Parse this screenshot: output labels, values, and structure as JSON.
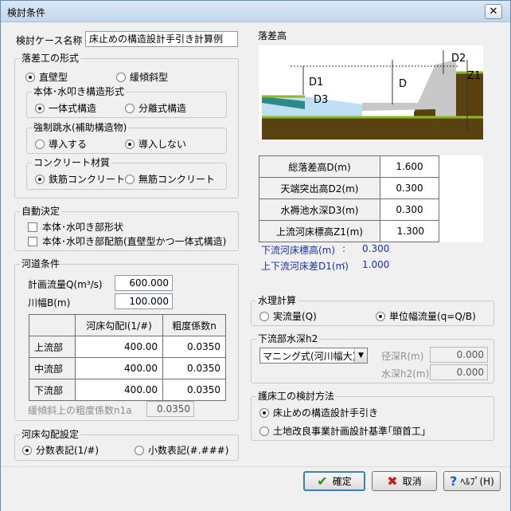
{
  "window": {
    "title": "検討条件",
    "close_glyph": "✕"
  },
  "case": {
    "label": "検討ケース名称",
    "value": "床止めの構造設計手引き計算例"
  },
  "drop_form": {
    "legend": "落差工の形式",
    "options": [
      "直壁型",
      "緩傾斜型"
    ],
    "selected": 0,
    "body": {
      "legend": "本体･水叩き構造形式",
      "options": [
        "一体式構造",
        "分離式構造"
      ],
      "selected": 0
    },
    "jump": {
      "legend": "強制跳水(補助構造物)",
      "options": [
        "導入する",
        "導入しない"
      ],
      "selected": 1
    },
    "concrete": {
      "legend": "コンクリート材質",
      "options": [
        "鉄筋コンクリート",
        "無筋コンクリート"
      ],
      "selected": 0
    }
  },
  "auto": {
    "legend": "自動決定",
    "items": [
      "本体･水叩き部形状",
      "本体･水叩き部配筋(直壁型かつ一体式構造)"
    ]
  },
  "river": {
    "legend": "河道条件",
    "flow_label": "計画流量Q(m³/s)",
    "flow_value": "600.000",
    "width_label": "川幅B(m)",
    "width_value": "100.000",
    "table": {
      "headers": [
        "",
        "河床勾配I(1/#)",
        "粗度係数n"
      ],
      "rows": [
        [
          "上流部",
          "400.00",
          "0.0350"
        ],
        [
          "中流部",
          "400.00",
          "0.0350"
        ],
        [
          "下流部",
          "400.00",
          "0.0350"
        ]
      ]
    },
    "slope_n_label": "緩傾斜上の粗度係数n1a",
    "slope_n_value": "0.0350"
  },
  "gradient_setting": {
    "legend": "河床勾配設定",
    "options": [
      "分数表記(1/#)",
      "小数表記(#.###)"
    ],
    "selected": 0
  },
  "drop_height": {
    "legend": "落差高",
    "diagram_labels": {
      "d1": "D1",
      "d2": "D2",
      "d3": "D3",
      "d": "D",
      "z1": "Z1"
    },
    "rows": [
      {
        "label": "総落差高D(m)",
        "value": "1.600"
      },
      {
        "label": "天端突出高D2(m)",
        "value": "0.300"
      },
      {
        "label": "水褥池水深D3(m)",
        "value": "0.300"
      },
      {
        "label": "上流河床標高Z1(m)",
        "value": "1.300"
      }
    ],
    "downstream_bed": {
      "label": "下流河床標高(m)",
      "sep": ":",
      "value": "0.300"
    },
    "bed_diff": {
      "label": "上下流河床差D1(m)",
      "sep": ":",
      "value": "1.000"
    }
  },
  "hydraulics": {
    "legend": "水理計算",
    "options": [
      "実流量(Q)",
      "単位幅流量(q=Q/B)"
    ],
    "selected": 1
  },
  "downstream_depth": {
    "legend": "下流部水深h2",
    "method": "マニング式(河川幅大)",
    "radius_label": "径深R(m)",
    "radius_value": "0.000",
    "depth_label": "水深h2(m)",
    "depth_value": "0.000"
  },
  "protection": {
    "legend": "護床工の検討方法",
    "options": [
      "床止めの構造設計手引き",
      "土地改良事業計画設計基準｢頭首工｣"
    ],
    "selected": 0
  },
  "buttons": {
    "ok": "確定",
    "cancel": "取消",
    "help": "ﾍﾙﾌﾟ(H)"
  },
  "colors": {
    "soil": "#5a4210",
    "grass": "#8fba1f",
    "concrete": "#c8c8c8",
    "water": "#bfe0f4",
    "arrow_line": "#333333"
  }
}
